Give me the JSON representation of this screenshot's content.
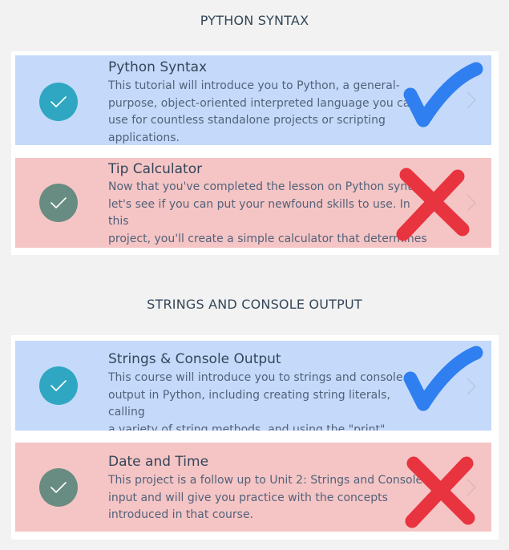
{
  "sections": [
    {
      "title": "PYTHON SYNTAX",
      "cards": [
        {
          "title": "Python Syntax",
          "description": "This tutorial will introduce you to Python, a general-\npurpose, object-oriented interpreted language you can\nuse for countless standalone projects or scripting\napplications.",
          "status_icon": "check-icon",
          "overlay_icon": "checkmark-icon"
        },
        {
          "title": "Tip Calculator",
          "description": "Now that you've completed the lesson on Python syntax,\nlet's see if you can put your newfound skills to use. In this\nproject, you'll create a simple calculator that determines\nthe price of a meal after tax and tip.",
          "status_icon": "check-icon",
          "overlay_icon": "x-icon"
        }
      ]
    },
    {
      "title": "STRINGS AND CONSOLE OUTPUT",
      "cards": [
        {
          "title": "Strings & Console Output",
          "description": "This course will introduce you to strings and console\noutput in Python, including creating string literals, calling\na variety of string methods, and using the \"print\" keyword.",
          "status_icon": "check-icon",
          "overlay_icon": "checkmark-icon"
        },
        {
          "title": "Date and Time",
          "description": "This project is a follow up to Unit 2: Strings and Console\ninput and will give you practice with the concepts\nintroduced in that course.",
          "status_icon": "check-icon",
          "overlay_icon": "x-icon"
        }
      ]
    }
  ],
  "colors": {
    "blue_card": "#c5dafa",
    "red_card": "#f5c5c5",
    "teal_circle": "#2fa7c2",
    "green_circle": "#688c82",
    "checkmark_overlay": "#2f7ff0",
    "x_overlay": "#e8343f"
  }
}
